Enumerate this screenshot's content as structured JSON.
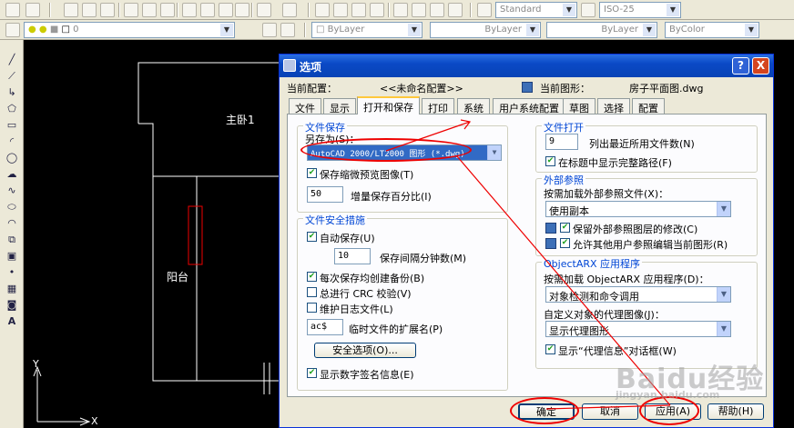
{
  "toolbar": {
    "textstyle": "Standard",
    "dimstyle": "ISO-25",
    "layer_value": "0",
    "color": "ByLayer",
    "linetype": "ByLayer",
    "lineweight": "ByLayer",
    "plotstyle": "ByColor"
  },
  "canvas": {
    "room_label": "主卧1",
    "balcony_label": "阳台",
    "axis_y": "Y",
    "axis_x": "X"
  },
  "dialog": {
    "title": "选项",
    "help_glyph": "?",
    "close_glyph": "X",
    "current_profile_label": "当前配置：",
    "current_profile_value": "<<未命名配置>>",
    "current_drawing_label": "当前图形：",
    "current_drawing_value": "房子平面图.dwg",
    "tabs": [
      "文件",
      "显示",
      "打开和保存",
      "打印",
      "系统",
      "用户系统配置",
      "草图",
      "选择",
      "配置"
    ],
    "active_tab_index": 2,
    "file_save": {
      "title": "文件保存",
      "save_as_label": "另存为(S)：",
      "save_as_value": "AutoCAD 2000/LT2000 图形 (*.dwg)",
      "save_thumbnail_label": "保存缩微预览图像(T)",
      "save_thumbnail_checked": true,
      "incremental_value": "50",
      "incremental_label": "增量保存百分比(I)"
    },
    "file_safety": {
      "title": "文件安全措施",
      "autosave_label": "自动保存(U)",
      "autosave_checked": true,
      "autosave_minutes": "10",
      "autosave_minutes_label": "保存间隔分钟数(M)",
      "backup_label": "每次保存均创建备份(B)",
      "backup_checked": true,
      "crc_label": "总进行 CRC 校验(V)",
      "crc_checked": false,
      "log_label": "维护日志文件(L)",
      "log_checked": false,
      "temp_ext_value": "ac$",
      "temp_ext_label": "临时文件的扩展名(P)",
      "security_button": "安全选项(O)...",
      "digital_sig_label": "显示数字签名信息(E)",
      "digital_sig_checked": true
    },
    "file_open": {
      "title": "文件打开",
      "recent_count": "9",
      "recent_label": "列出最近所用文件数(N)",
      "full_path_label": "在标题中显示完整路径(F)",
      "full_path_checked": true
    },
    "xref": {
      "title": "外部参照",
      "demand_load_label": "按需加载外部参照文件(X)：",
      "demand_load_value": "使用副本",
      "retain_changes_label": "保留外部参照图层的修改(C)",
      "retain_changes_checked": true,
      "allow_edit_label": "允许其他用户参照编辑当前图形(R)",
      "allow_edit_checked": true
    },
    "objectarx": {
      "title": "ObjectARX 应用程序",
      "demand_load_label": "按需加载 ObjectARX 应用程序(D)：",
      "demand_load_value": "对象检测和命令调用",
      "proxy_images_label": "自定义对象的代理图像(J)：",
      "proxy_images_value": "显示代理图形",
      "proxy_info_label": "显示“代理信息”对话框(W)",
      "proxy_info_checked": true
    },
    "buttons": {
      "ok": "确定",
      "cancel": "取消",
      "apply": "应用(A)",
      "help": "帮助(H)"
    }
  },
  "watermark": {
    "text": "Baidu经验",
    "sub": "jingyan.baidu.com"
  },
  "colors": {
    "title_bar": "#0a49c6",
    "group_title": "#0046d5",
    "annotation": "#ee0000",
    "canvas": "#000000"
  }
}
